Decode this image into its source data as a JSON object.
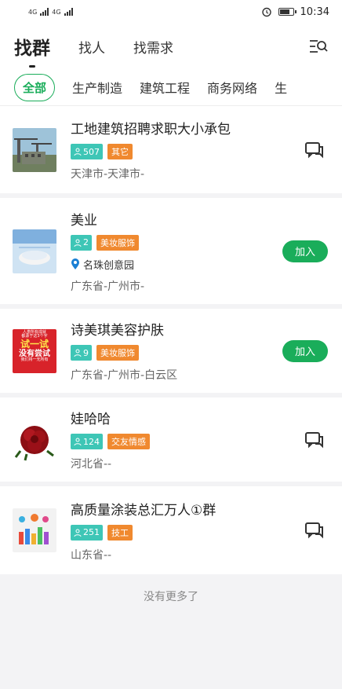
{
  "status": {
    "signal_1": "4G",
    "signal_2": "4G",
    "time": "10:34"
  },
  "header": {
    "tab_active": "找群",
    "tab_2": "找人",
    "tab_3": "找需求"
  },
  "categories": [
    "全部",
    "生产制造",
    "建筑工程",
    "商务网络",
    "生"
  ],
  "groups": [
    {
      "title": "工地建筑招聘求职大小承包",
      "count": "507",
      "tag": "其它",
      "location": "天津市-天津市-",
      "action": "chat"
    },
    {
      "title": "美业",
      "count": "2",
      "tag": "美妆服饰",
      "place": "名珠创意园",
      "location": "广东省-广州市-",
      "action": "join"
    },
    {
      "title": "诗美琪美容护肤",
      "count": "9",
      "tag": "美妆服饰",
      "location": "广东省-广州市-白云区",
      "action": "join"
    },
    {
      "title": "娃哈哈",
      "count": "124",
      "tag": "交友情感",
      "location": "河北省--",
      "action": "chat"
    },
    {
      "title": "高质量涂装总汇万人①群",
      "count": "251",
      "tag": "技工",
      "location": "山东省--",
      "action": "chat"
    }
  ],
  "join_label": "加入",
  "thumb3_text": [
    "人类所有成就",
    "都源于这3个字",
    "试一试",
    "没有尝试",
    "我们将一无所有"
  ],
  "end_text": "没有更多了"
}
